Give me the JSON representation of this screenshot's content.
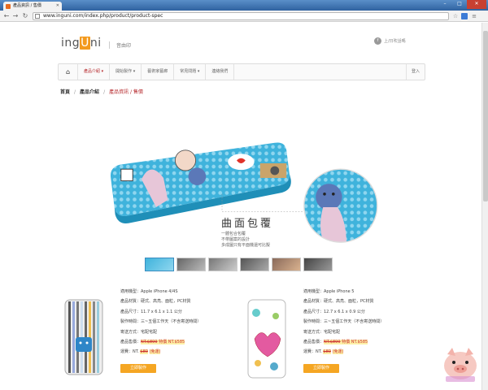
{
  "browser": {
    "tab_title": "產品資訊 / 售價",
    "url": "www.inguni.com/index.php/product/product-spec"
  },
  "site": {
    "logo_pre": "ing",
    "logo_u": "U",
    "logo_post": "ni",
    "logo_sub": "音由印",
    "login_link": "上/日吹話嗎"
  },
  "nav": {
    "items": [
      {
        "label": "產品介紹 ▾",
        "active": true
      },
      {
        "label": "開始製作 ▾",
        "active": false
      },
      {
        "label": "藝術家藝廊",
        "active": false
      },
      {
        "label": "常見問題 ▾",
        "active": false
      },
      {
        "label": "連絡我們",
        "active": false
      }
    ],
    "login": "登入"
  },
  "breadcrumb": {
    "home": "首頁",
    "section": "產品介紹",
    "current": "產品資訊 / 售價"
  },
  "hero": {
    "title": "曲面包覆",
    "line1": "一體包合包覆",
    "line2": "不帶圖案的設計",
    "line3": "多成圖只有平面機還可比擬"
  },
  "products": [
    {
      "model": "適用機型：Apple iPhone 4/4S",
      "material": "產品材質：硬式、高亮、面粒，PC材質",
      "size": "產品尺寸：11.7 x 6.1 x 1.1 公分",
      "time": "製作時間：三~五個工作天（不含寄送時間）",
      "ship": "寄送方式：宅配宅配",
      "price_label": "產品售價：",
      "price_old": "NT.$899",
      "price_new": "特價 NT.$585",
      "ship_label": "運費：NT.",
      "ship_old": "$80",
      "ship_free": "(免運)",
      "buy": "立即製作"
    },
    {
      "model": "適用機型：Apple iPhone 5",
      "material": "產品材質：硬式、高亮、面粒，PC材質",
      "size": "產品尺寸：12.7 x 6.1 x 0.9 公分",
      "time": "製作時間：三~五個工作天（不含寄送時間）",
      "ship": "寄送方式：宅配宅配",
      "price_label": "產品售價：",
      "price_old": "NT.$899",
      "price_new": "特價 NT.$585",
      "ship_label": "運費：NT.",
      "ship_old": "$80",
      "ship_free": "(免運)",
      "buy": "立即製作"
    }
  ],
  "colors": {
    "accent": "#f39a1e",
    "nav_active": "#b5262a",
    "case_blue": "#3fb3dc",
    "button": "#f5a623"
  }
}
